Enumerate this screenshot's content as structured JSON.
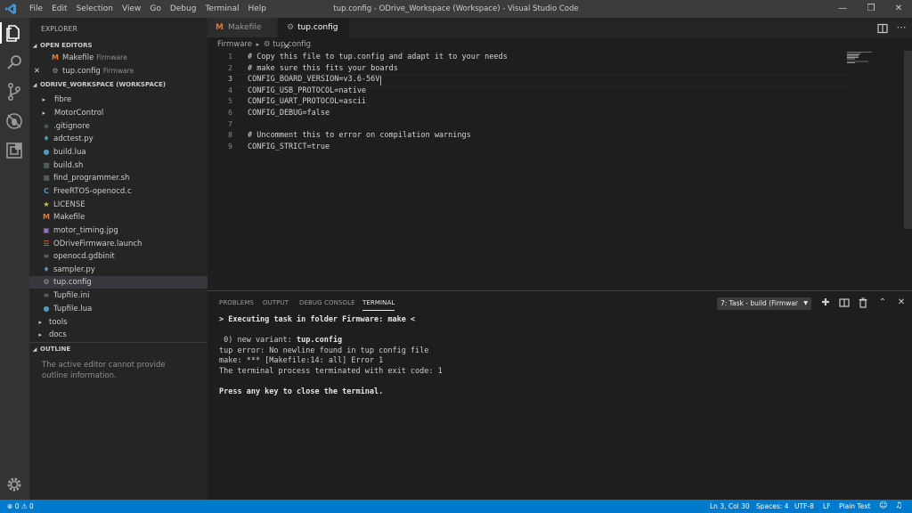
{
  "titlebar": {
    "menu": [
      "File",
      "Edit",
      "Selection",
      "View",
      "Go",
      "Debug",
      "Terminal",
      "Help"
    ],
    "window_title": "tup.config - ODrive_Workspace (Workspace) - Visual Studio Code"
  },
  "sidebar": {
    "title": "EXPLORER",
    "open_editors_label": "OPEN EDITORS",
    "open_editors": [
      {
        "name": "Makefile",
        "desc": "Firmware"
      },
      {
        "name": "tup.config",
        "desc": "Firmware"
      }
    ],
    "workspace_label": "ODRIVE_WORKSPACE (WORKSPACE)",
    "tree": [
      {
        "name": "fibre",
        "kind": "folder"
      },
      {
        "name": "MotorControl",
        "kind": "folder"
      },
      {
        "name": ".gitignore",
        "kind": "file",
        "icon": "git-icon"
      },
      {
        "name": "adctest.py",
        "kind": "file",
        "icon": "python-icon"
      },
      {
        "name": "build.lua",
        "kind": "file",
        "icon": "lua-icon"
      },
      {
        "name": "build.sh",
        "kind": "file",
        "icon": "shell-icon"
      },
      {
        "name": "find_programmer.sh",
        "kind": "file",
        "icon": "shell-icon"
      },
      {
        "name": "FreeRTOS-openocd.c",
        "kind": "file",
        "icon": "c-icon"
      },
      {
        "name": "LICENSE",
        "kind": "file",
        "icon": "license-icon"
      },
      {
        "name": "Makefile",
        "kind": "file",
        "icon": "makefile-icon"
      },
      {
        "name": "motor_timing.jpg",
        "kind": "file",
        "icon": "image-icon"
      },
      {
        "name": "ODriveFirmware.launch",
        "kind": "file",
        "icon": "xml-icon"
      },
      {
        "name": "openocd.gdbinit",
        "kind": "file",
        "icon": "file-icon"
      },
      {
        "name": "sampler.py",
        "kind": "file",
        "icon": "python-icon"
      },
      {
        "name": "tup.config",
        "kind": "file",
        "icon": "gear-icon"
      },
      {
        "name": "Tupfile.ini",
        "kind": "file",
        "icon": "file-icon"
      },
      {
        "name": "Tupfile.lua",
        "kind": "file",
        "icon": "lua-icon"
      },
      {
        "name": "tools",
        "kind": "rootfolder"
      },
      {
        "name": "docs",
        "kind": "rootfolder"
      }
    ],
    "outline_label": "OUTLINE",
    "outline_message": "The active editor cannot provide outline information."
  },
  "tabs": [
    {
      "label": "Makefile",
      "active": false
    },
    {
      "label": "tup.config",
      "active": true
    }
  ],
  "breadcrumb": {
    "folder": "Firmware",
    "file": "tup.config"
  },
  "editor": {
    "lines": [
      {
        "n": "1",
        "text": "# Copy this file to tup.config and adapt it to your needs"
      },
      {
        "n": "2",
        "text": "# make sure this fits your boards"
      },
      {
        "n": "3",
        "text": "CONFIG_BOARD_VERSION=v3.6-56V"
      },
      {
        "n": "4",
        "text": "CONFIG_USB_PROTOCOL=native"
      },
      {
        "n": "5",
        "text": "CONFIG_UART_PROTOCOL=ascii"
      },
      {
        "n": "6",
        "text": "CONFIG_DEBUG=false"
      },
      {
        "n": "7",
        "text": ""
      },
      {
        "n": "8",
        "text": "# Uncomment this to error on compilation warnings"
      },
      {
        "n": "9",
        "text": "CONFIG_STRICT=true"
      }
    ]
  },
  "panel": {
    "tabs": [
      "PROBLEMS",
      "OUTPUT",
      "DEBUG CONSOLE",
      "TERMINAL"
    ],
    "active_tab": "TERMINAL",
    "terminal_select": "7: Task - build (Firmwar",
    "terminal_lines": [
      "> Executing task in folder Firmware: make <",
      "",
      " 0) new variant: ",
      "tup error: No newline found in tup config file",
      "make: *** [Makefile:14: all] Error 1",
      "The terminal process terminated with exit code: 1",
      "",
      "Press any key to close the terminal."
    ],
    "variant_name": "tup.config"
  },
  "statusbar": {
    "errors": "0",
    "warnings": "0",
    "position": "Ln 3, Col 30",
    "spaces": "Spaces: 4",
    "encoding": "UTF-8",
    "eol": "LF",
    "language": "Plain Text"
  },
  "colors": {
    "accent": "#007acc",
    "makefile": "#e37933",
    "python": "#519aba",
    "folder": "#c5c5c5"
  }
}
